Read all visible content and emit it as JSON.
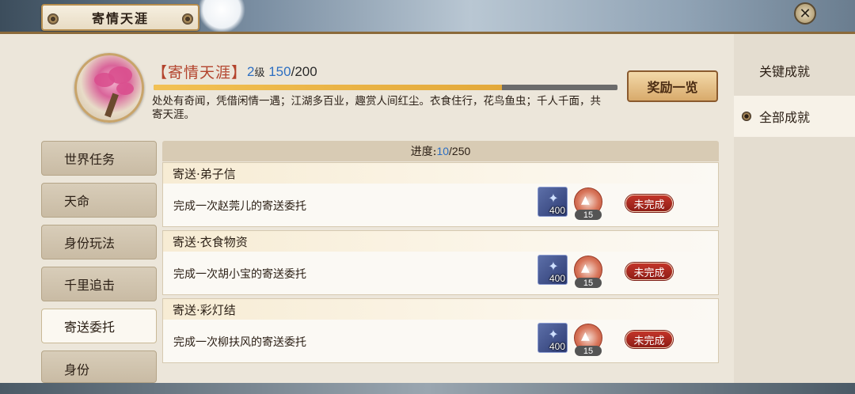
{
  "window": {
    "title": "寄情天涯",
    "close_icon": "close-icon"
  },
  "header": {
    "title": "【寄情天涯】",
    "level_number": "2",
    "level_unit": "级",
    "exp_current": "150",
    "exp_total": "/200",
    "exp_fraction": 0.75,
    "description": "处处有奇闻，凭借闲情一遇；江湖多百业，趣赏人间红尘。衣食住行，花鸟鱼虫；千人千面，共寄天涯。",
    "reward_button": "奖励一览"
  },
  "right_tabs": [
    {
      "label": "关键成就",
      "active": false
    },
    {
      "label": "全部成就",
      "active": true
    }
  ],
  "left_tabs": [
    {
      "label": "世界任务",
      "active": false
    },
    {
      "label": "天命",
      "active": false
    },
    {
      "label": "身份玩法",
      "active": false
    },
    {
      "label": "千里追击",
      "active": false
    },
    {
      "label": "寄送委托",
      "active": true
    },
    {
      "label": "身份",
      "active": false
    }
  ],
  "progress": {
    "label": "进度:",
    "current": "10",
    "total": "/250"
  },
  "quests": [
    {
      "title": "寄送·弟子信",
      "desc": "完成一次赵莞儿的寄送委托",
      "reward_card": "400",
      "reward_coin": "15",
      "status": "未完成"
    },
    {
      "title": "寄送·衣食物资",
      "desc": "完成一次胡小宝的寄送委托",
      "reward_card": "400",
      "reward_coin": "15",
      "status": "未完成"
    },
    {
      "title": "寄送·彩灯结",
      "desc": "完成一次柳扶风的寄送委托",
      "reward_card": "400",
      "reward_coin": "15",
      "status": "未完成"
    }
  ]
}
